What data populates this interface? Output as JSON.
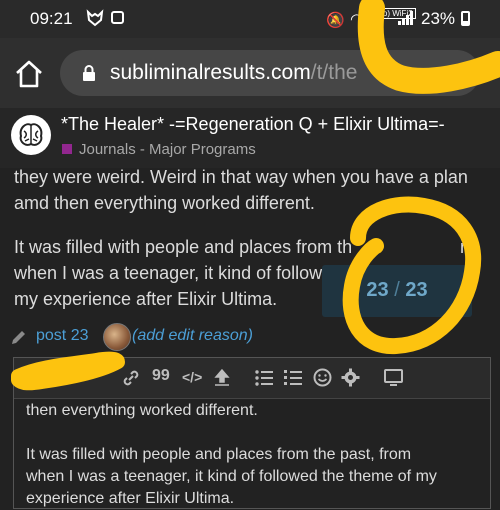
{
  "status_bar": {
    "time": "09:21",
    "volte_label": "Vo) WiFi2",
    "battery": "23%",
    "battery_level": 0.23
  },
  "browser": {
    "url_host": "subliminalresults.com",
    "url_path": "/t/the"
  },
  "topic": {
    "title": "*The Healer* -=Regeneration Q + Elixir Ultima=-",
    "category": "Journals - Major Programs",
    "category_color": "#92278f"
  },
  "post": {
    "lines": [
      "they were weird. Weird in that way when you have a plan",
      "amd then everything worked different.",
      "It was filled with people and places from th",
      "when I was a teenager, it kind of follow",
      "my experience after Elixir Ultima."
    ],
    "line_fragment": "m"
  },
  "progress": {
    "current": "23",
    "separator": "/",
    "total": "23"
  },
  "footer": {
    "post_link": "post 23",
    "edit_reason": "(add edit reason)"
  },
  "editor": {
    "lines": [
      "then everything worked different.",
      "",
      "It was filled with people and places from the past, from",
      "when I was a teenager, it kind of followed the theme of my",
      "experience after Elixir Ultima."
    ],
    "toolbar_quote": "99",
    "toolbar_code": "</>"
  },
  "colors": {
    "background": "#222222",
    "link": "#4c9fd6",
    "highlight_scribble": "#fdc30f",
    "progress_text": "#6fa8c9"
  }
}
